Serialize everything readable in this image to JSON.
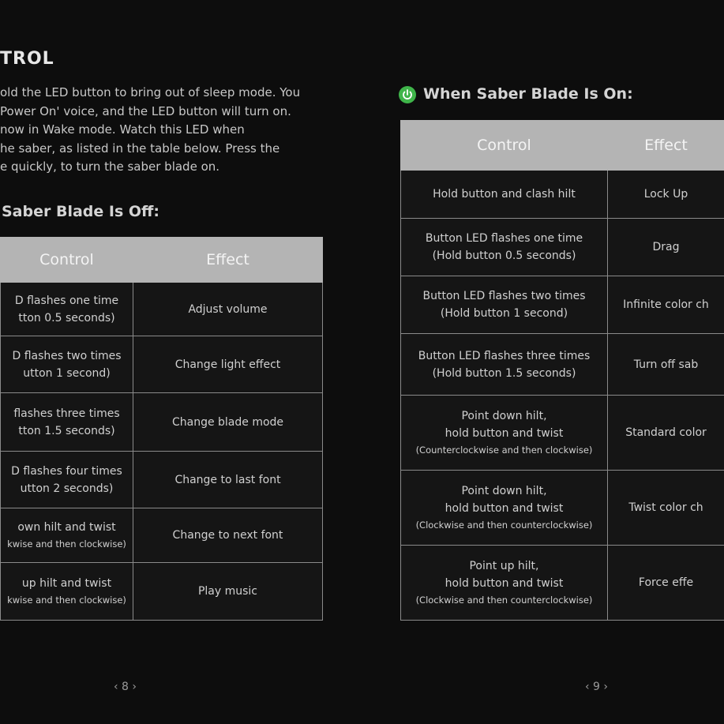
{
  "left_page": {
    "title": "TROL",
    "paragraph": [
      "old the LED button to bring out of sleep mode. You",
      "Power On' voice, and the LED button will turn on.",
      "now in Wake mode. Watch this LED when",
      "he saber, as listed in the table below. Press the",
      "e quickly, to turn the saber blade on."
    ],
    "subtitle": "Saber Blade Is Off:",
    "table": {
      "headers": [
        "Control",
        "Effect"
      ],
      "rows": [
        {
          "control": [
            "D flashes one time",
            "tton 0.5 seconds)"
          ],
          "effect": "Adjust volume"
        },
        {
          "control": [
            "D flashes two times",
            "utton 1 second)"
          ],
          "effect": "Change light effect"
        },
        {
          "control": [
            "flashes three times",
            "tton 1.5 seconds)"
          ],
          "effect": "Change blade mode"
        },
        {
          "control": [
            "D flashes four times",
            "utton 2 seconds)"
          ],
          "effect": "Change to last font"
        },
        {
          "control": [
            "own hilt and twist",
            "kwise and then clockwise)"
          ],
          "effect": "Change to next font"
        },
        {
          "control": [
            "up hilt and twist",
            "kwise and then clockwise)"
          ],
          "effect": "Play music"
        }
      ]
    },
    "page_number": "‹ 8 ›"
  },
  "right_page": {
    "icon": "power-icon",
    "accent_color": "#3fb54a",
    "subtitle": "When Saber Blade Is On:",
    "table": {
      "headers": [
        "Control",
        "Effect"
      ],
      "rows": [
        {
          "control": [
            "Hold button and clash hilt"
          ],
          "effect": "Lock Up"
        },
        {
          "control": [
            "Button LED flashes one time",
            "(Hold button 0.5 seconds)"
          ],
          "effect": "Drag"
        },
        {
          "control": [
            "Button LED flashes two times",
            "(Hold button 1 second)"
          ],
          "effect": "Infinite color ch"
        },
        {
          "control": [
            "Button LED flashes three times",
            "(Hold button 1.5 seconds)"
          ],
          "effect": "Turn off sab"
        },
        {
          "control": [
            "Point down hilt,",
            "hold button and twist",
            "(Counterclockwise and then clockwise)"
          ],
          "effect": "Standard color"
        },
        {
          "control": [
            "Point down hilt,",
            "hold button and twist",
            "(Clockwise and then counterclockwise)"
          ],
          "effect": "Twist color ch"
        },
        {
          "control": [
            "Point up hilt,",
            "hold button and twist",
            "(Clockwise and then counterclockwise)"
          ],
          "effect": "Force effe"
        }
      ]
    },
    "page_number": "‹ 9 ›"
  }
}
